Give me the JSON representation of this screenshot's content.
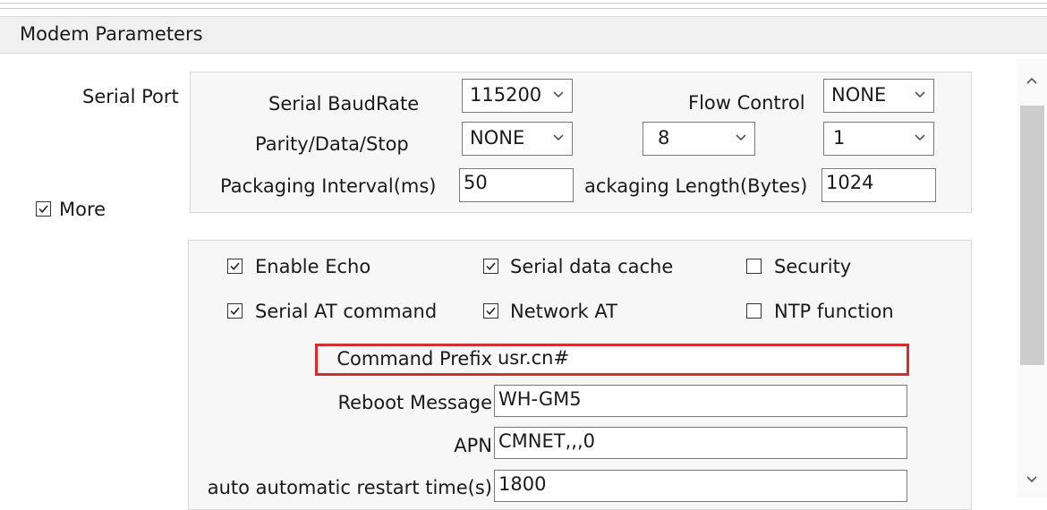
{
  "section": {
    "title": "Modem Parameters"
  },
  "serial_port": {
    "label": "Serial Port",
    "baud_label": "Serial BaudRate",
    "baud_value": "115200",
    "flow_label": "Flow Control",
    "flow_value": "NONE",
    "pds_label": "Parity/Data/Stop",
    "parity_value": "NONE",
    "data_value": "8",
    "stop_value": "1",
    "interval_label": "Packaging Interval(ms)",
    "interval_value": "50",
    "length_label": "ackaging Length(Bytes)",
    "length_value": "1024"
  },
  "more": {
    "label": "More",
    "checked": true
  },
  "options": {
    "enable_echo": {
      "label": "Enable Echo",
      "checked": true
    },
    "serial_data_cache": {
      "label": "Serial data cache",
      "checked": true
    },
    "security": {
      "label": "Security",
      "checked": false
    },
    "serial_at_command": {
      "label": "Serial AT command",
      "checked": true
    },
    "network_at": {
      "label": "Network AT",
      "checked": true
    },
    "ntp_function": {
      "label": "NTP function",
      "checked": false
    }
  },
  "fields": {
    "command_prefix_label": "Command Prefix",
    "command_prefix_value": "usr.cn#",
    "reboot_message_label": "Reboot Message",
    "reboot_message_value": "WH-GM5",
    "apn_label": "APN",
    "apn_value": "CMNET,,,0",
    "restart_label": "auto automatic restart time(s)",
    "restart_value": "1800"
  },
  "icons": {
    "chevron": "chevron-down-icon",
    "check": "check-icon",
    "scroll_up": "scroll-up-icon",
    "scroll_down": "scroll-down-icon"
  },
  "colors": {
    "highlight": "#d32f2f",
    "panel_bg": "#f7f7f7",
    "header_bg": "#f0f0f0"
  }
}
